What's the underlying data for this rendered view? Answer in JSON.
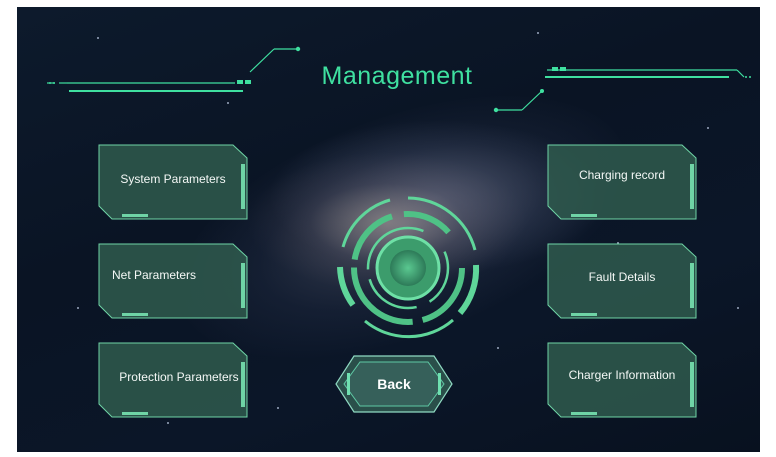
{
  "title": "Management",
  "left_menu": [
    {
      "label": "System Parameters"
    },
    {
      "label": "Net Parameters"
    },
    {
      "label": "Protection Parameters"
    }
  ],
  "right_menu": [
    {
      "label": "Charging record"
    },
    {
      "label": "Fault Details"
    },
    {
      "label": "Charger Information"
    }
  ],
  "back_label": "Back",
  "colors": {
    "accent": "#3fe0a0",
    "panel_fill": "#2f5a4e",
    "panel_border": "#6fd4a6",
    "background": "#0c1728"
  }
}
